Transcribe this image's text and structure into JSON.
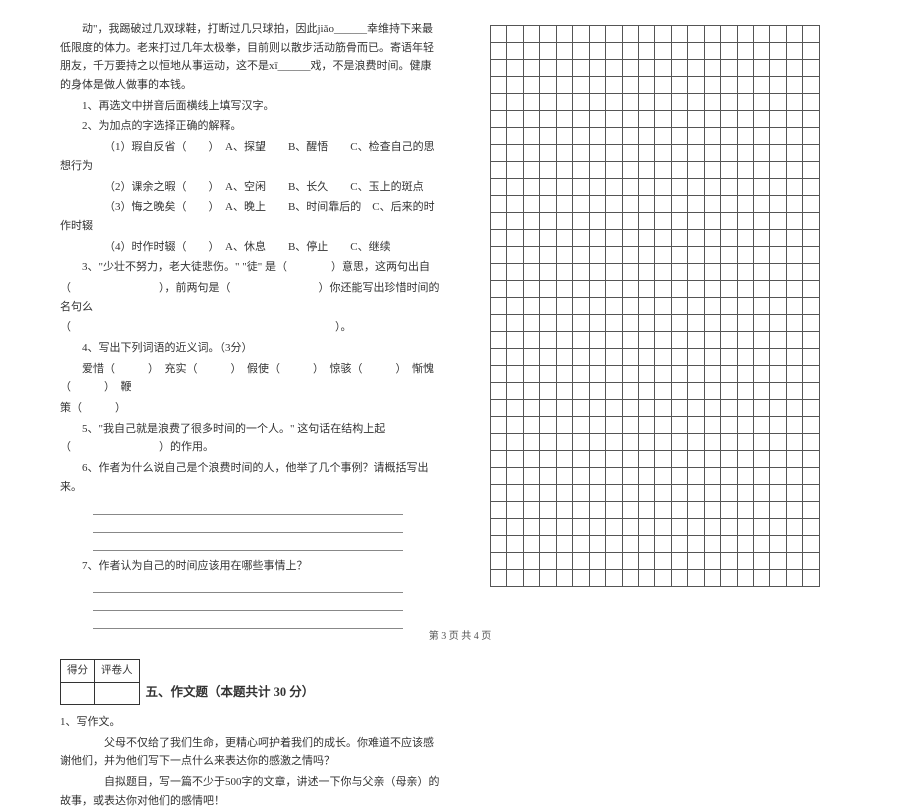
{
  "passage": {
    "tail1": "动\"，我踢破过几双球鞋，打断过几只球拍，因此jiǎo______幸维持下来最低限度的体力。老来打过几年太极拳，目前则以散步活动筋骨而已。寄语年轻朋友，千万要持之以恒地从事运动，这不是xī______戏，不是浪费时间。健康的身体是做人做事的本钱。"
  },
  "q1": "1、再选文中拼音后面横线上填写汉字。",
  "q2": {
    "stem": "2、为加点的字选择正确的解释。",
    "a": "（1）瑕自反省（　　）　A、探望　　B、醒悟　　C、检查自己的思想行为",
    "b": "（2）课余之暇（　　）　A、空闲　　B、长久　　C、玉上的斑点",
    "c": "（3）悔之晚矣（　　）　A、晚上　　B、时间靠后的　C、后来的时作时辍",
    "d": "（4）时作时辍（　　）　A、休息　　B、停止　　C、继续"
  },
  "q3": {
    "a": "3、\"少壮不努力，老大徒悲伤。\" \"徒\" 是（　　　　）意思，这两句出自",
    "b": "（　　　　　　　　），前两句是（　　　　　　　　）你还能写出珍惜时间的名句么",
    "c": "（　　　　　　　　　　　　　　　　　　　　　　　　）。"
  },
  "q4": {
    "stem": "4、写出下列词语的近义词。（3分）",
    "line1": "爱惜（　　　）　充实（　　　）　假使（　　　）　惊骇（　　　）　惭愧（　　　）　鞭",
    "line2": "策（　　　）"
  },
  "q5": "5、\"我自己就是浪费了很多时间的一个人。\" 这句话在结构上起（　　　　　　　　）的作用。",
  "q6": "6、作者为什么说自己是个浪费时间的人，他举了几个事例？请概括写出来。",
  "q7": "7、作者认为自己的时间应该用在哪些事情上？",
  "scoreHeaders": {
    "score": "得分",
    "grader": "评卷人"
  },
  "section5": {
    "title": "五、作文题（本题共计 30 分）",
    "q": "1、写作文。",
    "p1": "父母不仅给了我们生命，更精心呵护着我们的成长。你难道不应该感谢他们，并为他们写下一点什么来表达你的感激之情吗？",
    "p2": "自拟题目，写一篇不少于500字的文章，讲述一下你与父亲（母亲）的故事，或表达你对他们的感情吧！"
  },
  "footer": "第 3 页 共 4 页",
  "grid": {
    "cols": 20,
    "rows": 33
  }
}
